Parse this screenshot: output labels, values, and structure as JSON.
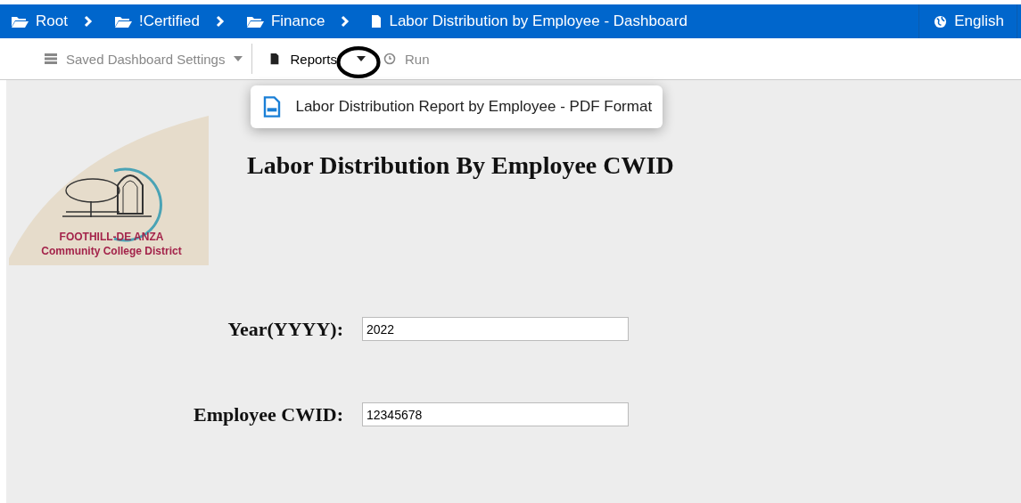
{
  "breadcrumbs": [
    {
      "label": "Root",
      "kind": "folder"
    },
    {
      "label": "!Certified",
      "kind": "folder"
    },
    {
      "label": "Finance",
      "kind": "folder"
    },
    {
      "label": "Labor Distribution by Employee - Dashboard",
      "kind": "document"
    }
  ],
  "language": "English",
  "toolbar": {
    "saved_settings": {
      "label": "Saved Dashboard Settings",
      "disabled": true
    },
    "reports": {
      "label": "Reports",
      "expanded": true,
      "items": [
        {
          "label": "Labor Distribution Report by Employee - PDF Format"
        }
      ]
    },
    "run": {
      "label": "Run",
      "disabled": true
    }
  },
  "logo": {
    "lines": [
      "FOOTHILL-DE ANZA",
      "Community College District"
    ]
  },
  "title": "Labor Distribution By Employee CWID",
  "fields": [
    {
      "label": "Year(YYYY):",
      "value": "2022"
    },
    {
      "label": "Employee CWID:",
      "value": "12345678"
    }
  ]
}
